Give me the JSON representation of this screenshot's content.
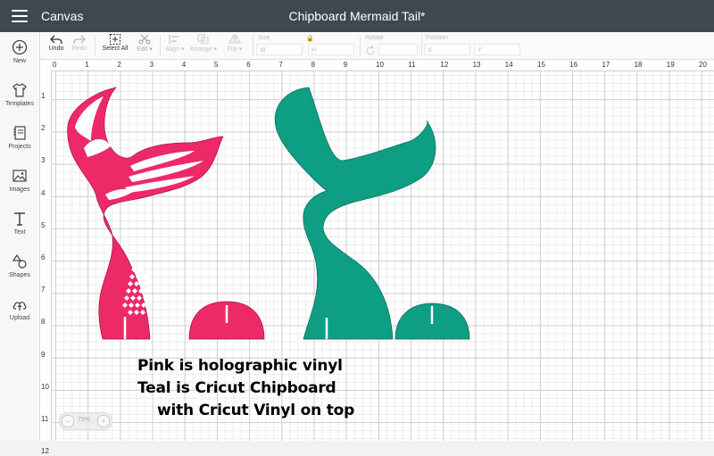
{
  "header": {
    "app_name": "Canvas",
    "project_title": "Chipboard Mermaid Tail*"
  },
  "sidebar": {
    "items": [
      {
        "label": "New",
        "icon": "plus-circle-icon"
      },
      {
        "label": "Templates",
        "icon": "tshirt-icon"
      },
      {
        "label": "Projects",
        "icon": "projects-icon"
      },
      {
        "label": "Images",
        "icon": "images-icon"
      },
      {
        "label": "Text",
        "icon": "text-icon"
      },
      {
        "label": "Shapes",
        "icon": "shapes-icon"
      },
      {
        "label": "Upload",
        "icon": "upload-cloud-icon"
      }
    ]
  },
  "toolbar": {
    "undo": "Undo",
    "redo": "Redo",
    "select_all": "Select All",
    "edit": "Edit",
    "align": "Align",
    "arrange": "Arrange",
    "flip": "Flip",
    "size_label": "Size",
    "w_label": "W",
    "h_label": "H",
    "rotate_label": "Rotate",
    "position_label": "Position",
    "x_label": "X",
    "y_label": "Y"
  },
  "rulers": {
    "top": [
      "0",
      "1",
      "2",
      "3",
      "4",
      "5",
      "6",
      "7",
      "8",
      "9",
      "10",
      "11",
      "12",
      "13",
      "14",
      "15",
      "16",
      "17",
      "18",
      "19",
      "20"
    ],
    "left": [
      "1",
      "2",
      "3",
      "4",
      "5",
      "6",
      "7",
      "8",
      "9",
      "10",
      "11",
      "12"
    ]
  },
  "canvas": {
    "caption_lines": [
      "Pink is holographic vinyl",
      "Teal is Cricut Chipboard",
      "with Cricut Vinyl on top"
    ]
  },
  "zoom": {
    "value": "75%",
    "minus": "−",
    "plus": "+"
  },
  "colors": {
    "header_bg": "#3f4850",
    "pink_vinyl": "#ee2968",
    "teal_chipboard": "#0e9e84"
  }
}
